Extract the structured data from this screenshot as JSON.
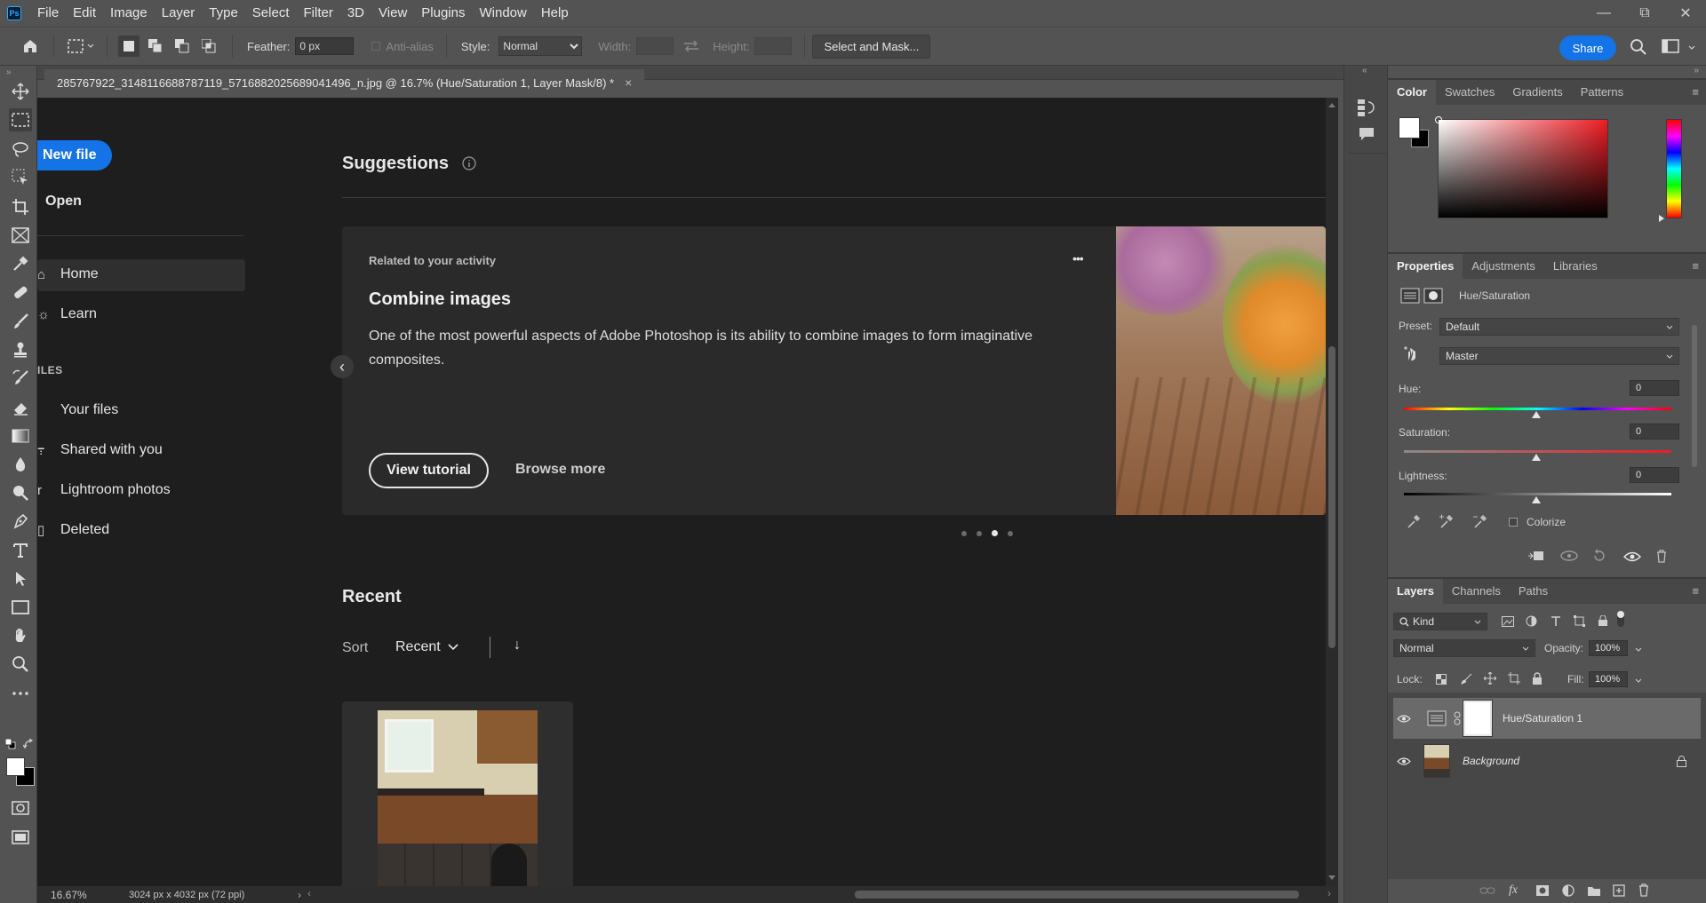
{
  "app": {
    "logo": "Ps"
  },
  "menu": [
    "File",
    "Edit",
    "Image",
    "Layer",
    "Type",
    "Select",
    "Filter",
    "3D",
    "View",
    "Plugins",
    "Window",
    "Help"
  ],
  "window_controls": {
    "minimize": "—",
    "restore": "⧉",
    "close": "✕"
  },
  "options": {
    "feather_label": "Feather:",
    "feather_value": "0 px",
    "antialias_label": "Anti-alias",
    "style_label": "Style:",
    "style_value": "Normal",
    "width_label": "Width:",
    "height_label": "Height:",
    "select_mask_label": "Select and Mask...",
    "share_label": "Share"
  },
  "document": {
    "tab_title": "285767922_3148116688787119_5716882025689041496_n.jpg @ 16.7% (Hue/Saturation 1, Layer Mask/8) *",
    "close": "×"
  },
  "home": {
    "new_file": "New file",
    "open": "Open",
    "nav": [
      {
        "label": "Home",
        "icon": "home-icon",
        "glyph": "⌂"
      },
      {
        "label": "Learn",
        "icon": "lightbulb-icon",
        "glyph": "☼"
      }
    ],
    "files_heading": "ILES",
    "files_nav": [
      {
        "label": "Your files",
        "icon": "cloud-icon",
        "glyph": ""
      },
      {
        "label": "Shared with you",
        "icon": "people-icon",
        "glyph": "߹"
      },
      {
        "label": "Lightroom photos",
        "icon": "lightroom-icon",
        "glyph": "r"
      },
      {
        "label": "Deleted",
        "icon": "trash-icon",
        "glyph": "▯"
      }
    ],
    "suggestions_title": "Suggestions",
    "suggestion": {
      "eyebrow": "Related to your activity",
      "title": "Combine images",
      "body": "One of the most powerful aspects of Adobe Photoshop is its ability to combine images to form imaginative composites.",
      "cta_primary": "View tutorial",
      "cta_secondary": "Browse more",
      "more": "•••",
      "prev": "‹",
      "active_page": 3,
      "page_count": 4
    },
    "recent_title": "Recent",
    "sort_label": "Sort",
    "sort_value": "Recent",
    "sort_dir": "↓"
  },
  "status": {
    "zoom": "16.67%",
    "size": "3024 px x 4032 px (72 ppi)",
    "arrow": "›",
    "left": "‹",
    "right": "›"
  },
  "color_panel": {
    "tabs": [
      "Color",
      "Swatches",
      "Gradients",
      "Patterns"
    ],
    "active": "Color",
    "fg": "#ffffff",
    "bg": "#000000",
    "hue": "#ee1c24"
  },
  "properties": {
    "tabs": [
      "Properties",
      "Adjustments",
      "Libraries"
    ],
    "active": "Properties",
    "title": "Hue/Saturation",
    "preset_label": "Preset:",
    "preset_value": "Default",
    "channel_value": "Master",
    "hue_label": "Hue:",
    "hue_value": "0",
    "saturation_label": "Saturation:",
    "saturation_value": "0",
    "lightness_label": "Lightness:",
    "lightness_value": "0",
    "colorize_label": "Colorize"
  },
  "layers_panel": {
    "tabs": [
      "Layers",
      "Channels",
      "Paths"
    ],
    "active": "Layers",
    "kind_label": "Kind",
    "blend_mode": "Normal",
    "opacity_label": "Opacity:",
    "opacity_value": "100%",
    "lock_label": "Lock:",
    "fill_label": "Fill:",
    "fill_value": "100%",
    "layers": [
      {
        "name": "Hue/Saturation 1",
        "selected": true
      },
      {
        "name": "Background",
        "selected": false
      }
    ]
  }
}
